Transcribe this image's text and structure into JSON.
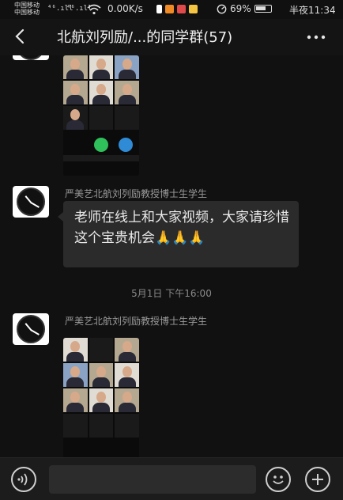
{
  "statusbar": {
    "carrier1": "中国移动",
    "carrier2": "中国移动",
    "signal1": "⁴⁶.ıll",
    "signal2": "⁴⁶.ıll",
    "speed": "0.00K/s",
    "battery_pct": "69%",
    "battery_level": 0.69,
    "time": "半夜11:34"
  },
  "header": {
    "title": "北航刘列励/...的同学群(57)"
  },
  "messages": [
    {
      "type": "image",
      "desc_tiles": "video-call-grid"
    },
    {
      "type": "text",
      "sender": "严美艺北航刘列励教授博士生学生",
      "text": "老师在线上和大家视频，大家请珍惜这个宝贵机会🙏🙏🙏"
    },
    {
      "type": "timestamp",
      "text": "5月1日 下午16:00"
    },
    {
      "type": "image",
      "sender": "严美艺北航刘列励教授博士生学生"
    }
  ],
  "colors": {
    "background": "#111111",
    "bubble": "#2b2b2b",
    "accent_green": "#2fbf5b",
    "accent_blue": "#2f8bd6"
  },
  "icons": {
    "back": "chevron-left-icon",
    "more": "more-dots-icon",
    "voice": "voice-input-icon",
    "emoji": "emoji-icon",
    "plus": "plus-icon"
  }
}
